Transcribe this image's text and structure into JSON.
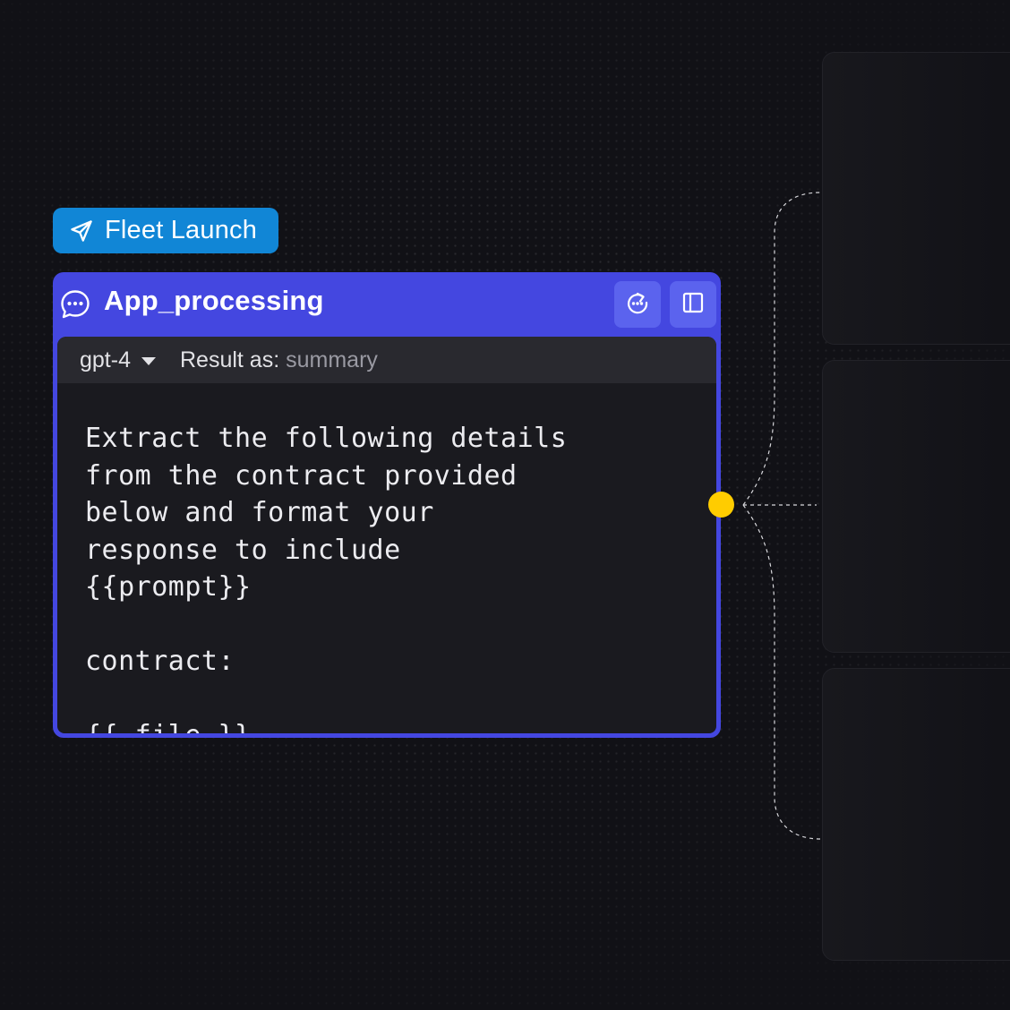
{
  "tag": {
    "icon": "send-icon",
    "label": "Fleet Launch",
    "color": "#1186d6"
  },
  "node": {
    "icon": "chat-icon",
    "title": "App_processing",
    "accent": "#4447e0",
    "actions": [
      {
        "icon": "refresh-timer-icon"
      },
      {
        "icon": "sidebar-panel-icon"
      }
    ],
    "model": "gpt-4",
    "result_label": "Result as:",
    "result_value": "summary",
    "prompt": "Extract the following details\nfrom the contract provided\nbelow and format your\nresponse to include\n{{prompt}}\n\ncontract:\n\n{{ file }}"
  },
  "connector": {
    "color": "#ffcc00"
  }
}
